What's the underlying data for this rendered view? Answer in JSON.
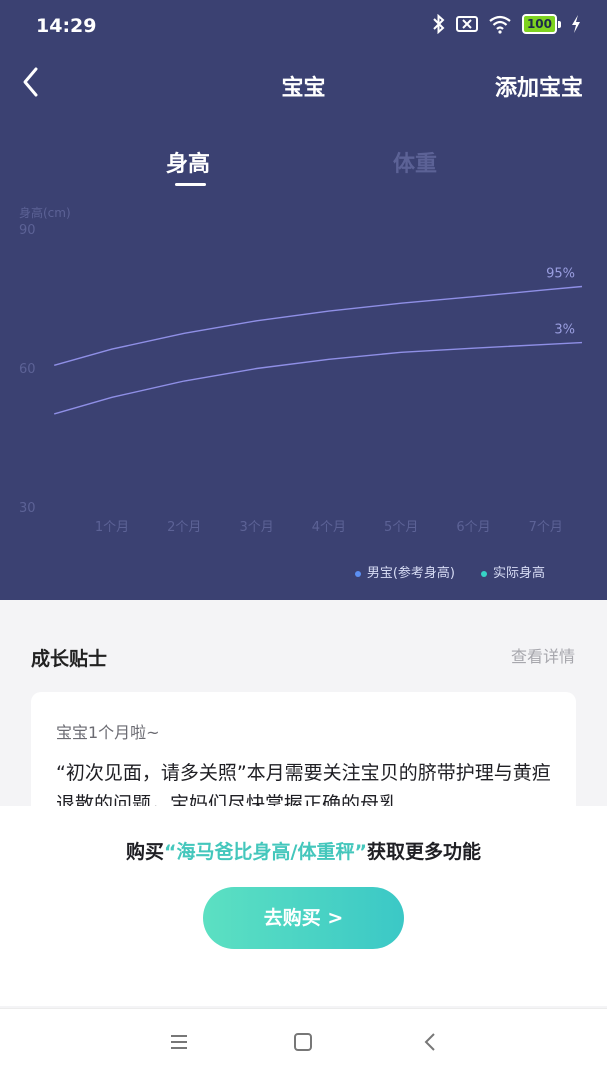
{
  "status_bar": {
    "time": "14:29",
    "battery": "100"
  },
  "nav": {
    "title": "宝宝",
    "add_label": "添加宝宝"
  },
  "tabs": [
    {
      "label": "身高",
      "active": true
    },
    {
      "label": "体重",
      "active": false
    }
  ],
  "chart_data": {
    "type": "line",
    "ylabel": "身高(cm)",
    "y_ticks": [
      "90",
      "60",
      "30"
    ],
    "ylim": [
      30,
      90
    ],
    "categories": [
      "1个月",
      "2个月",
      "3个月",
      "4个月",
      "5个月",
      "6个月",
      "7个月"
    ],
    "x": [
      0.2,
      1,
      2,
      3,
      4,
      5,
      6,
      7,
      7.5
    ],
    "series": [
      {
        "name": "95%",
        "values": [
          60.8,
          64.3,
          67.7,
          70.4,
          72.5,
          74.2,
          75.6,
          77.1,
          77.8
        ]
      },
      {
        "name": "3%",
        "values": [
          50.3,
          53.9,
          57.4,
          60.1,
          62.1,
          63.6,
          64.5,
          65.3,
          65.7
        ]
      }
    ],
    "legend": [
      {
        "label": "男宝(参考身高)",
        "color": "#5c8ff2"
      },
      {
        "label": "实际身高",
        "color": "#36d3c6"
      }
    ]
  },
  "tips": {
    "title": "成长贴士",
    "more": "查看详情",
    "card_title": "宝宝1个月啦~",
    "card_body": "“初次见面，请多关照”本月需要关注宝贝的脐带护理与黄疸退散的问题，宝妈们尽快掌握正确的母乳..."
  },
  "promo": {
    "prefix": "购买",
    "product": "“海马爸比身高/体重秤”",
    "suffix": "获取更多功能",
    "button": "去购买 >"
  },
  "colors": {
    "header_bg": "#3b4172",
    "accent": "#44c7bc",
    "line": "#8f8fe6"
  }
}
